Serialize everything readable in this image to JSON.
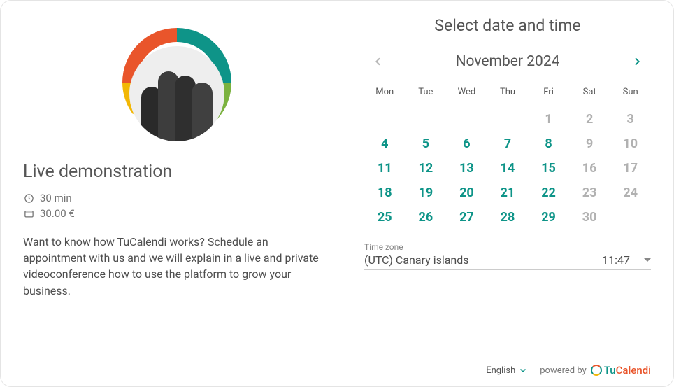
{
  "event": {
    "title": "Live demonstration",
    "duration": "30 min",
    "price": "30.00 €",
    "description": "Want to know how TuCalendi works? Schedule an appointment with us and we will explain in a live and private videoconference how to use the platform to grow your business."
  },
  "right": {
    "heading": "Select date and time",
    "month_label": "November 2024"
  },
  "calendar": {
    "weekdays": [
      "Mon",
      "Tue",
      "Wed",
      "Thu",
      "Fri",
      "Sat",
      "Sun"
    ],
    "cells": [
      {
        "d": "",
        "state": "empty"
      },
      {
        "d": "",
        "state": "empty"
      },
      {
        "d": "",
        "state": "empty"
      },
      {
        "d": "",
        "state": "empty"
      },
      {
        "d": "1",
        "state": "unavail"
      },
      {
        "d": "2",
        "state": "unavail"
      },
      {
        "d": "3",
        "state": "unavail"
      },
      {
        "d": "4",
        "state": "avail"
      },
      {
        "d": "5",
        "state": "avail"
      },
      {
        "d": "6",
        "state": "avail"
      },
      {
        "d": "7",
        "state": "avail"
      },
      {
        "d": "8",
        "state": "avail"
      },
      {
        "d": "9",
        "state": "unavail"
      },
      {
        "d": "10",
        "state": "unavail"
      },
      {
        "d": "11",
        "state": "avail"
      },
      {
        "d": "12",
        "state": "avail"
      },
      {
        "d": "13",
        "state": "avail"
      },
      {
        "d": "14",
        "state": "avail"
      },
      {
        "d": "15",
        "state": "avail"
      },
      {
        "d": "16",
        "state": "unavail"
      },
      {
        "d": "17",
        "state": "unavail"
      },
      {
        "d": "18",
        "state": "avail"
      },
      {
        "d": "19",
        "state": "avail"
      },
      {
        "d": "20",
        "state": "avail"
      },
      {
        "d": "21",
        "state": "avail"
      },
      {
        "d": "22",
        "state": "avail"
      },
      {
        "d": "23",
        "state": "unavail"
      },
      {
        "d": "24",
        "state": "unavail"
      },
      {
        "d": "25",
        "state": "avail"
      },
      {
        "d": "26",
        "state": "avail"
      },
      {
        "d": "27",
        "state": "avail"
      },
      {
        "d": "28",
        "state": "avail"
      },
      {
        "d": "29",
        "state": "avail"
      },
      {
        "d": "30",
        "state": "unavail"
      },
      {
        "d": "",
        "state": "empty"
      }
    ]
  },
  "timezone": {
    "label": "Time zone",
    "name": "(UTC) Canary islands",
    "time": "11:47"
  },
  "footer": {
    "language": "English",
    "powered_by": "powered by",
    "brand_a": "Tu",
    "brand_b": "Calendi"
  }
}
